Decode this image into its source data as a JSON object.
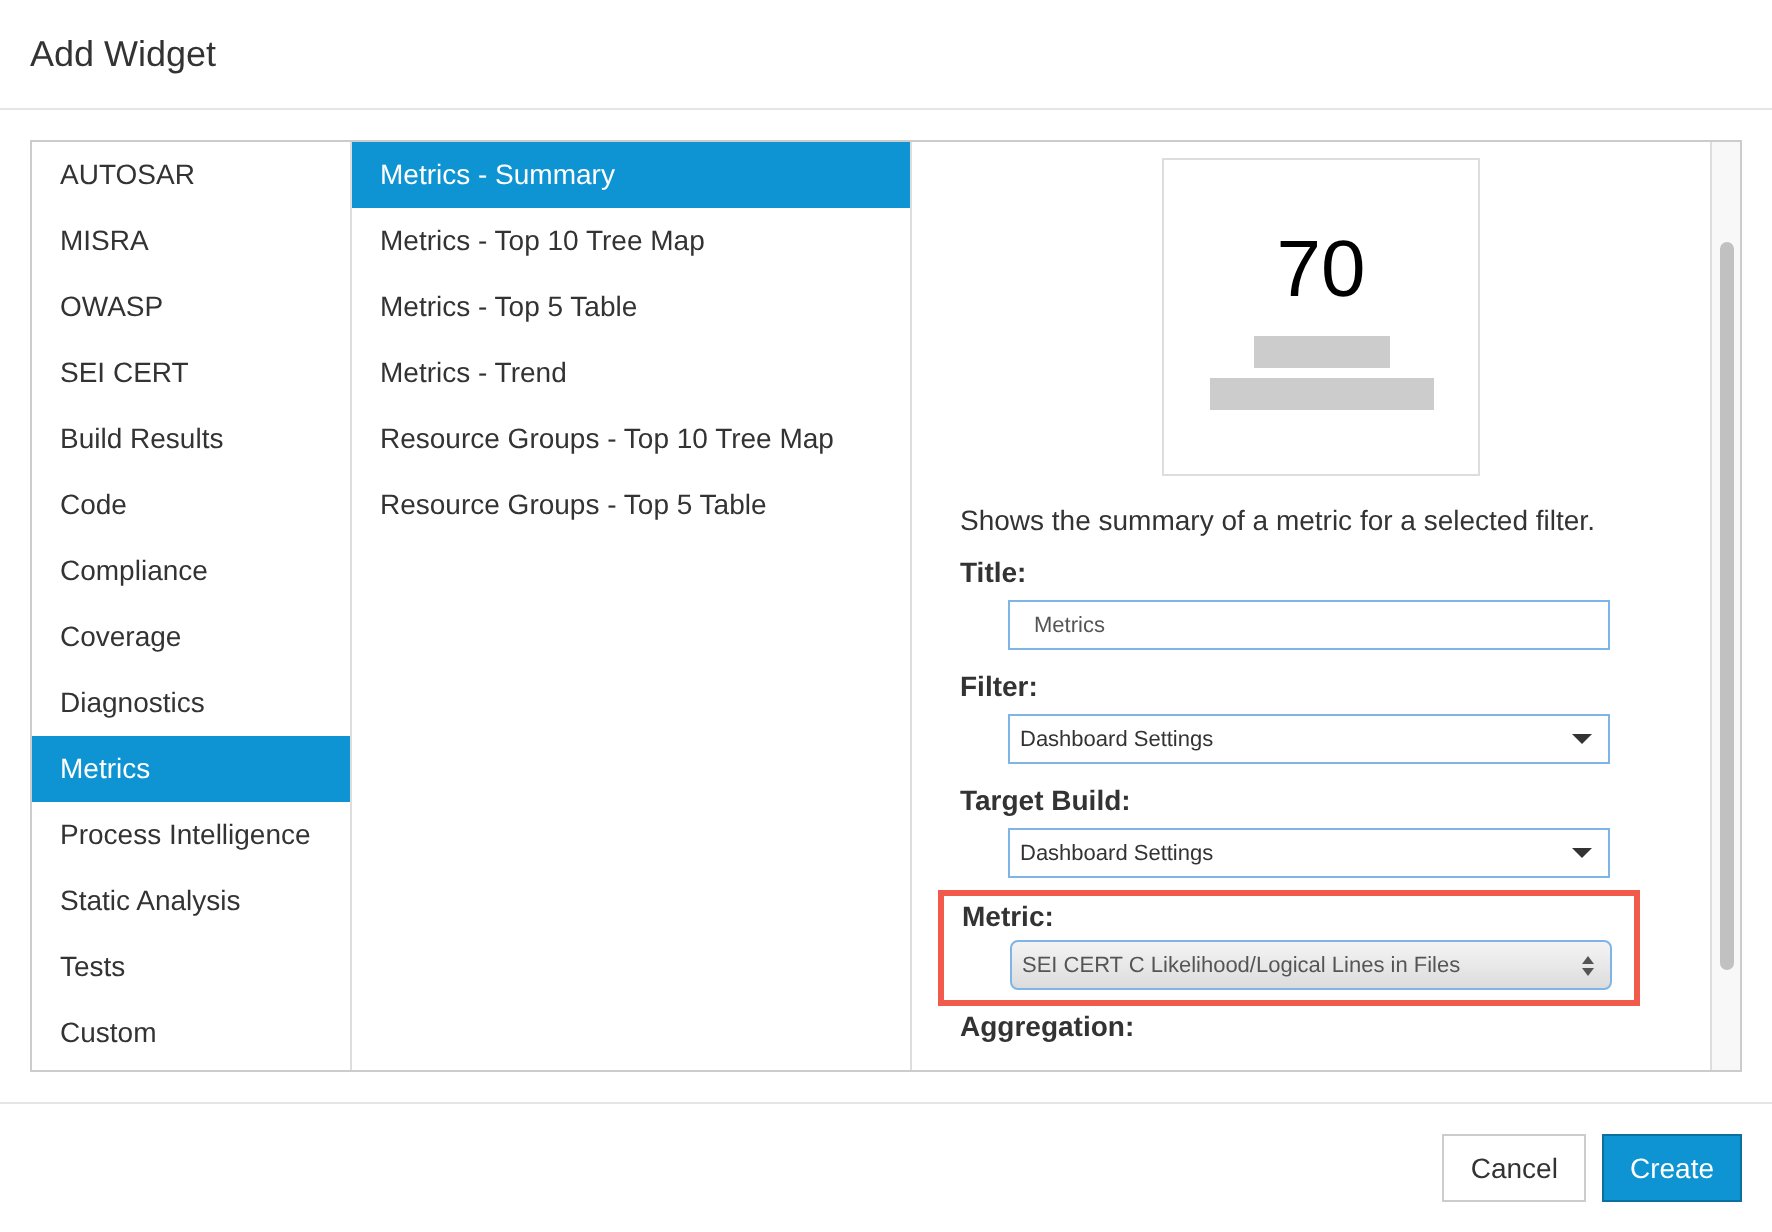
{
  "dialog": {
    "title": "Add Widget"
  },
  "categories": [
    {
      "label": "AUTOSAR",
      "selected": false
    },
    {
      "label": "MISRA",
      "selected": false
    },
    {
      "label": "OWASP",
      "selected": false
    },
    {
      "label": "SEI CERT",
      "selected": false
    },
    {
      "label": "Build Results",
      "selected": false
    },
    {
      "label": "Code",
      "selected": false
    },
    {
      "label": "Compliance",
      "selected": false
    },
    {
      "label": "Coverage",
      "selected": false
    },
    {
      "label": "Diagnostics",
      "selected": false
    },
    {
      "label": "Metrics",
      "selected": true
    },
    {
      "label": "Process Intelligence",
      "selected": false
    },
    {
      "label": "Static Analysis",
      "selected": false
    },
    {
      "label": "Tests",
      "selected": false
    },
    {
      "label": "Custom",
      "selected": false
    }
  ],
  "widgets": [
    {
      "label": "Metrics - Summary",
      "selected": true
    },
    {
      "label": "Metrics - Top 10 Tree Map",
      "selected": false
    },
    {
      "label": "Metrics - Top 5 Table",
      "selected": false
    },
    {
      "label": "Metrics - Trend",
      "selected": false
    },
    {
      "label": "Resource Groups - Top 10 Tree Map",
      "selected": false
    },
    {
      "label": "Resource Groups - Top 5 Table",
      "selected": false
    }
  ],
  "preview": {
    "value": "70"
  },
  "description": "Shows the summary of a metric for a selected filter.",
  "fields": [
    {
      "label": "Title:",
      "kind": "text",
      "value": "Metrics",
      "highlighted": false
    },
    {
      "label": "Filter:",
      "kind": "select",
      "value": "Dashboard Settings",
      "highlighted": false
    },
    {
      "label": "Target Build:",
      "kind": "select",
      "value": "Dashboard Settings",
      "highlighted": false
    },
    {
      "label": "Metric:",
      "kind": "spinner",
      "value": "SEI CERT C Likelihood/Logical Lines in Files",
      "highlighted": true
    },
    {
      "label": "Aggregation:",
      "kind": "label",
      "highlighted": false
    }
  ],
  "buttons": [
    {
      "label": "Cancel",
      "kind": "secondary"
    },
    {
      "label": "Create",
      "kind": "primary"
    }
  ]
}
